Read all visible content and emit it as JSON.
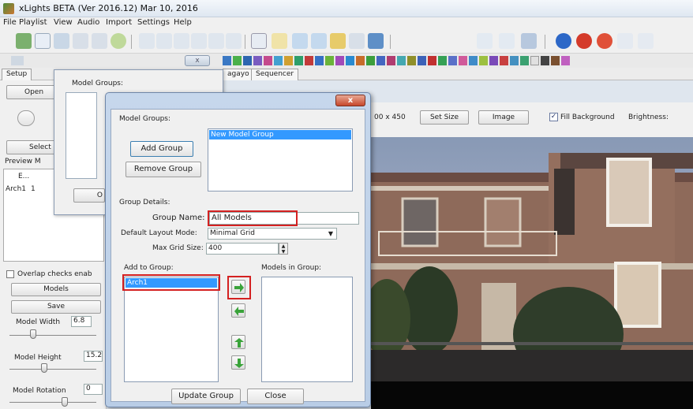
{
  "window": {
    "title": "xLights BETA (Ver 2016.12) Mar 10, 2016"
  },
  "menu": [
    "File",
    "Playlist",
    "View",
    "Audio",
    "Import",
    "Settings",
    "Help"
  ],
  "tabs": [
    "Setup",
    "",
    "agayo",
    "Sequencer"
  ],
  "left_panel": {
    "open_label": "Open",
    "select_label": "Select",
    "preview_label": "Preview M",
    "col_e": "E...",
    "row_name": "Arch1",
    "row_val": "1",
    "overlap_label": "Overlap checks enab",
    "models_label": "Models",
    "save_label": "Save",
    "model_width_label": "Model Width",
    "model_width_value": "6.8",
    "model_height_label": "Model Height",
    "model_height_value": "15.2",
    "model_rotation_label": "Model Rotation",
    "model_rotation_value": "0"
  },
  "back_dialog": {
    "title": "Model Groups:",
    "button_label": "O"
  },
  "right_toolbar": {
    "size_text": "00 x 450",
    "set_size_label": "Set Size",
    "image_label": "Image",
    "fill_background_label": "Fill Background",
    "brightness_label": "Brightness:"
  },
  "dialog": {
    "close_glyph": "x",
    "model_groups_label": "Model Groups:",
    "groups": [
      "New Model Group"
    ],
    "add_group_label": "Add Group",
    "remove_group_label": "Remove Group",
    "group_details_label": "Group Details:",
    "group_name_label": "Group Name:",
    "group_name_value": "All Models",
    "layout_mode_label": "Default Layout Mode:",
    "layout_mode_value": "Minimal Grid",
    "max_grid_label": "Max Grid Size:",
    "max_grid_value": "400",
    "add_to_group_label": "Add to Group:",
    "add_to_group_items": [
      "Arch1"
    ],
    "models_in_group_label": "Models in Group:",
    "update_group_label": "Update Group",
    "close_label": "Close"
  },
  "colors": {
    "highlight": "#d42121",
    "selection": "#3399ff",
    "arrow_green": "#3aa33a"
  }
}
